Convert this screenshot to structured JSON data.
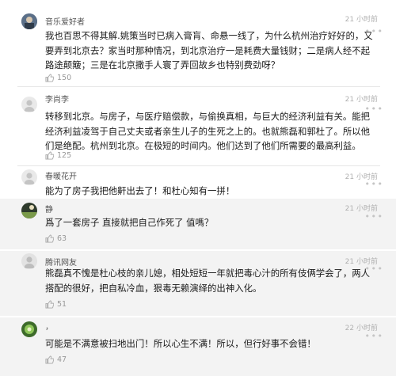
{
  "comments": [
    {
      "user": "音乐爱好者",
      "time": "21 小时前",
      "text": "我也百思不得其解.姚策当时已病入膏肓、命悬一线了，为什么杭州治疗好好的，又要弄到北京去？家当时那种情况，到北京治疗一是耗费大量钱财；二是病人经不起路途颠簸；三是在北京撒手人寰了弄回故乡也特别费劲呀？",
      "likes": "150"
    },
    {
      "user": "李尚李",
      "time": "21 小时前",
      "text": "转移到北京。与房子，与医疗赔偿款，与偷换真相，与巨大的经济利益有关。能把经济利益凌驾于自己丈夫或者亲生儿子的生死之上的。也就熊磊和郭杜了。所以他们是绝配。杭州到北京。在极短的时间内。他们达到了他们所需要的最高利益。",
      "likes": "125"
    },
    {
      "user": "春暖花开",
      "time": "21 小时前",
      "text": "能为了房子我把他鼾出去了！和杜心知有一拼！",
      "likes": ""
    },
    {
      "user": "静",
      "time": "21 小时前",
      "text": "爲了一套房子 直接就把自己作死了 值嗎？",
      "likes": "63"
    },
    {
      "user": "腾讯网友",
      "time": "21 小时前",
      "text": "熊磊真不愧是杜心枝的亲儿媳，相处短短一年就把毒心汁的所有伎俩学会了，两人搭配的很好，把自私冷血，狠毒无赖演绎的出神入化。",
      "likes": "51"
    },
    {
      "user": "，",
      "time": "22 小时前",
      "text": "可能是不满意被扫地出门！所以心生不满！所以，但行好事不会错！",
      "likes": "47"
    }
  ],
  "more_icon": "more-dots-icon",
  "like_icon": "thumb-up-icon",
  "colors": {
    "card_gray": "#f3f3f3",
    "text": "#1a1a1a",
    "meta": "#999999"
  }
}
